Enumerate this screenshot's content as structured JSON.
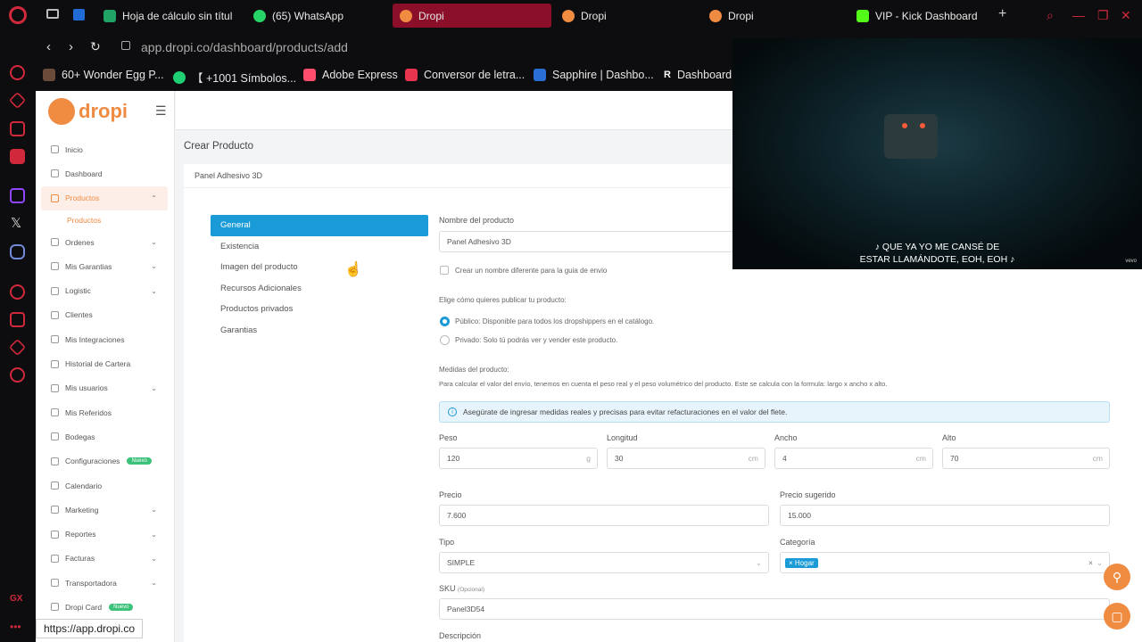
{
  "browser": {
    "tabs": [
      {
        "label": "Hoja de cálculo sin títul",
        "icon": "sheets-icon",
        "color": "#21a366"
      },
      {
        "label": "(65) WhatsApp",
        "icon": "whatsapp-icon",
        "color": "#25d366"
      },
      {
        "label": "Dropi",
        "icon": "dropi-icon",
        "color": "#f08b42",
        "active": true
      },
      {
        "label": "Dropi",
        "icon": "dropi-icon",
        "color": "#f08b42"
      },
      {
        "label": "Dropi",
        "icon": "dropi-icon",
        "color": "#f08b42"
      },
      {
        "label": "VIP - Kick Dashboard",
        "icon": "kick-icon",
        "color": "#53fc18"
      }
    ],
    "url": "app.dropi.co/dashboard/products/add",
    "bookmarks": [
      {
        "label": "60+ Wonder Egg P..."
      },
      {
        "label": "【 +1001 Símbolos..."
      },
      {
        "label": "Adobe Express"
      },
      {
        "label": "Conversor de letra..."
      },
      {
        "label": "Sapphire | Dashbo..."
      },
      {
        "label": "Dashboard"
      }
    ],
    "status_url": "https://app.dropi.co",
    "accent": "#d0293b"
  },
  "app": {
    "logo": "dropi",
    "brand_color": "#f08b42",
    "menu": [
      {
        "label": "Inicio"
      },
      {
        "label": "Dashboard"
      },
      {
        "label": "Productos",
        "active": true,
        "chevron": "up"
      },
      {
        "label": "Ordenes",
        "chevron": "down"
      },
      {
        "label": "Mis Garantias",
        "chevron": "down"
      },
      {
        "label": "Logistic",
        "chevron": "down"
      },
      {
        "label": "Clientes"
      },
      {
        "label": "Mis Integraciones"
      },
      {
        "label": "Historial de Cartera"
      },
      {
        "label": "Mis usuarios",
        "chevron": "down"
      },
      {
        "label": "Mis Referidos"
      },
      {
        "label": "Bodegas"
      },
      {
        "label": "Configuraciones",
        "badge": "Nuevo"
      },
      {
        "label": "Calendario"
      },
      {
        "label": "Marketing",
        "chevron": "down"
      },
      {
        "label": "Reportes",
        "chevron": "down"
      },
      {
        "label": "Facturas",
        "chevron": "down"
      },
      {
        "label": "Transportadora",
        "chevron": "down"
      },
      {
        "label": "Dropi Card",
        "badge": "Nuevo"
      }
    ],
    "submenu_productos": "Productos",
    "page_title": "Crear Producto",
    "card_title": "Panel Adhesivo 3D",
    "tabs": [
      "General",
      "Existencia",
      "Imagen del producto",
      "Recursos Adicionales",
      "Productos privados",
      "Garantias"
    ],
    "form": {
      "name_label": "Nombre del producto",
      "name_value": "Panel Adhesivo 3D",
      "diff_name_label": "Crear un nombre diferente para la guia de envio",
      "publish_label": "Elige cómo quieres publicar tu producto:",
      "public_label": "Público:",
      "public_desc": "Disponible para todos los dropshippers en el catálogo.",
      "private_label": "Privado:",
      "private_desc": "Solo tú podrás ver y vender este producto.",
      "measures_label": "Medidas del producto:",
      "measures_desc": "Para calcular el valor del envío, tenemos en cuenta el peso real y el peso volumétrico del producto. Este se calcula con la formula: largo x ancho x alto.",
      "alert": "Asegúrate de ingresar medidas reales y precisas para evitar refacturaciones en el valor del flete.",
      "peso_label": "Peso",
      "peso_value": "120",
      "peso_unit": "g",
      "longitud_label": "Longitud",
      "longitud_value": "30",
      "longitud_unit": "cm",
      "ancho_label": "Ancho",
      "ancho_value": "4",
      "ancho_unit": "cm",
      "alto_label": "Alto",
      "alto_value": "70",
      "alto_unit": "cm",
      "precio_label": "Precio",
      "precio_value": "7.600",
      "precio_sug_label": "Precio sugerido",
      "precio_sug_value": "15.000",
      "tipo_label": "Tipo",
      "tipo_value": "SIMPLE",
      "categoria_label": "Categoría",
      "categoria_tag": "Hogar",
      "sku_label": "SKU",
      "sku_optional": "(Opcional)",
      "sku_value": "Panel3D54",
      "descripcion_label": "Descripción"
    }
  },
  "video": {
    "subtitle_line1": "♪ QUE YA YO ME CANSÉ DE",
    "subtitle_line2": "ESTAR LLAMÁNDOTE, EOH, EOH ♪",
    "watermark": "vevo"
  }
}
